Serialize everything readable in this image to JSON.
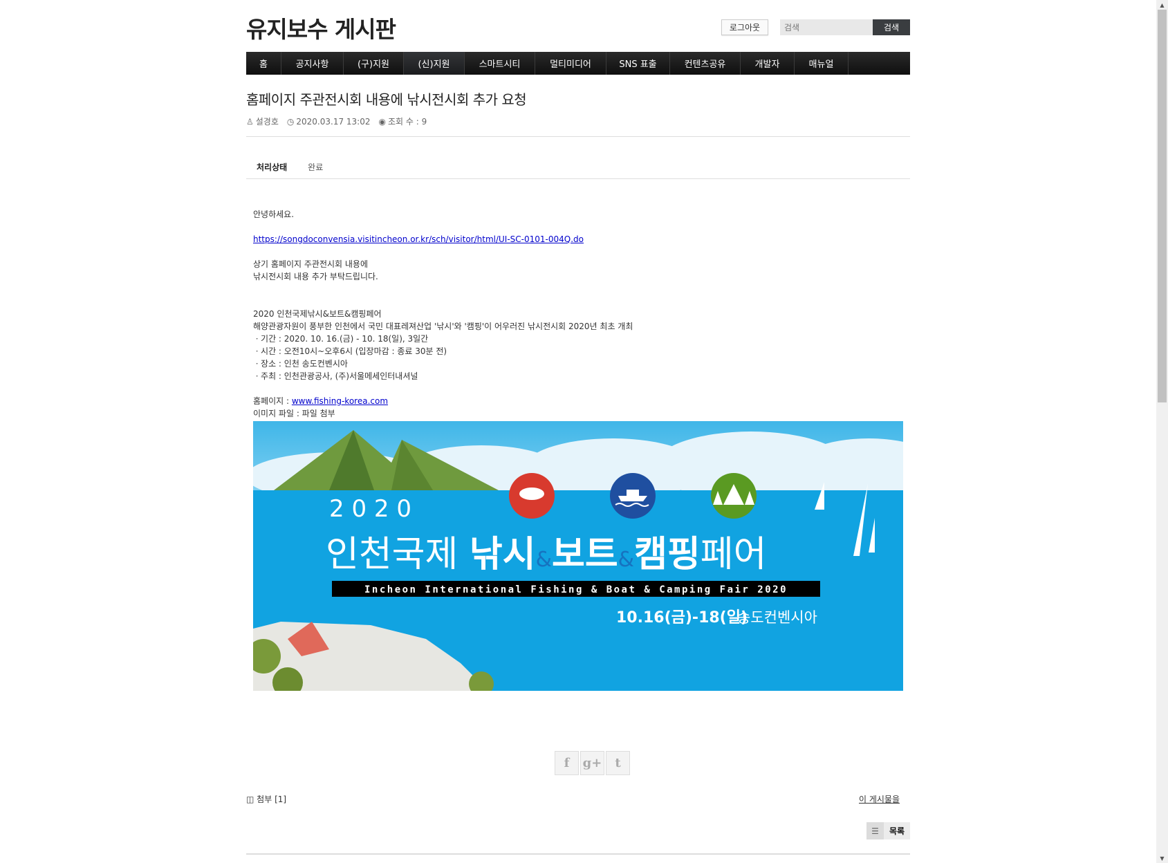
{
  "header": {
    "site_title": "유지보수 게시판",
    "logout": "로그아웃",
    "search_placeholder": "검색",
    "search_button": "검색"
  },
  "nav": [
    "홈",
    "공지사항",
    "(구)지원",
    "(신)지원",
    "스마트시티",
    "멀티미디어",
    "SNS 표출",
    "컨텐츠공유",
    "개발자",
    "매뉴얼"
  ],
  "post": {
    "title": "홈페이지 주관전시회 내용에 낚시전시회 추가 요청",
    "author": "설경호",
    "date": "2020.03.17 13:02",
    "views": "조회 수 : 9",
    "status_label": "처리상태",
    "status_value": "완료",
    "greeting": "안녕하세요.",
    "link": "https://songdoconvensia.visitincheon.or.kr/sch/visitor/html/UI-SC-0101-004Q.do",
    "request_1": "상기 홈페이지 주관전시회 내용에",
    "request_2": "낚시전시회 내용 추가 부탁드립니다.",
    "event_name": "2020 인천국제낚시&보트&캠핑페어",
    "event_desc": "해양관광자원이 풍부한 인천에서 국민 대표레져산업 '낚시'와 '캠핑'이 어우러진 낚시전시회 2020년 최초 개최",
    "period": "ㆍ기간 : 2020. 10. 16.(금) - 10. 18(일), 3일간",
    "time": "ㆍ시간 : 오전10시~오후6시 (입장마감 : 종료 30분 전)",
    "place": "ㆍ장소 : 인천 송도컨벤시아",
    "host": "ㆍ주최 : 인천관광공사, (주)서울메세인터내셔널",
    "homepage_label": "홈페이지 : ",
    "homepage_link": "www.fishing-korea.com",
    "image_file": "이미지 파일 : 파일 첨부"
  },
  "banner": {
    "year": "2 0 2 0",
    "title_a": "인천국제 ",
    "title_b": "낚시",
    "amp": "&",
    "title_c": "보트",
    "title_d": "캠핑",
    "title_e": "페어",
    "english": "Incheon International Fishing & Boat & Camping Fair 2020",
    "date": "10.16(금)-18(일)",
    "venue": "송도컨벤시아"
  },
  "social": {
    "facebook": "f",
    "google": "g+",
    "twitter": "t"
  },
  "footer": {
    "attach": "첨부 [1]",
    "this_post": "이 게시물을",
    "list_button": "목록"
  }
}
